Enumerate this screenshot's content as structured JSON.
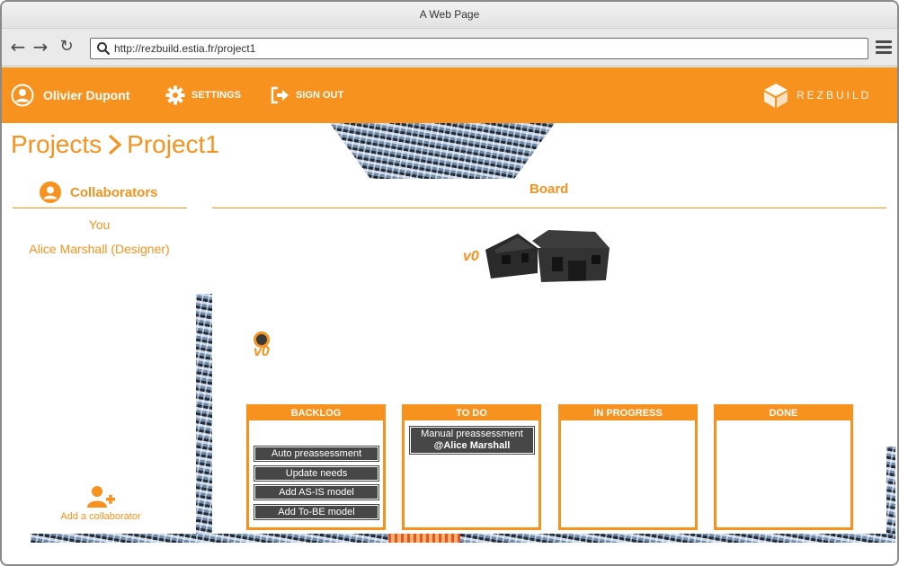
{
  "browser": {
    "title": "A Web Page",
    "url": "http://rezbuild.estia.fr/project1"
  },
  "header": {
    "user_name": "Olivier Dupont",
    "settings_label": "SETTINGS",
    "signout_label": "SIGN OUT",
    "brand": "REZBUILD"
  },
  "breadcrumb": {
    "root": "Projects",
    "current": "Project1"
  },
  "collaborators": {
    "title": "Collaborators",
    "items": [
      "You",
      "Alice Marshall (Designer)"
    ],
    "add_label": "Add a collaborator"
  },
  "board": {
    "title": "Board",
    "model_version": "v0",
    "timeline_version": "v0",
    "columns": [
      {
        "title": "BACKLOG",
        "tasks": [
          "Auto preassessment",
          "Update needs",
          "Add AS-IS model",
          "Add To-BE model"
        ]
      },
      {
        "title": "TO DO",
        "tasks": [
          {
            "name": "Manual preassessment",
            "assignee": "@Alice Marshall"
          }
        ]
      },
      {
        "title": "IN PROGRESS",
        "tasks": []
      },
      {
        "title": "DONE",
        "tasks": []
      }
    ]
  },
  "colors": {
    "accent": "#f7921e",
    "task_bg": "#474747"
  }
}
